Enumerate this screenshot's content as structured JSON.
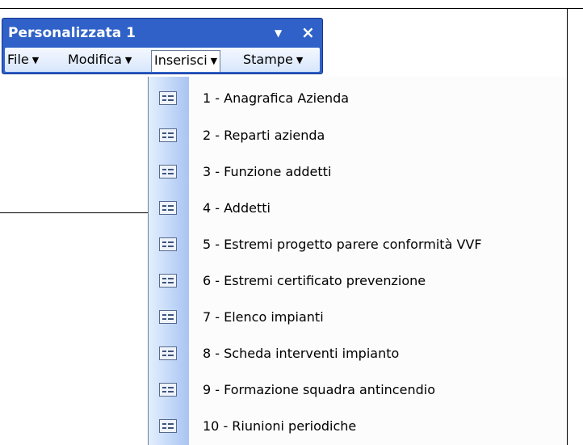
{
  "toolbar": {
    "title": "Personalizzata 1",
    "dropdown_glyph": "▼",
    "close_glyph": "×"
  },
  "menubar": {
    "items": [
      {
        "label": "File",
        "caret": "▼"
      },
      {
        "label": "Modifica",
        "caret": "▼"
      },
      {
        "label": "Inserisci",
        "caret": "▼"
      },
      {
        "label": "Stampe",
        "caret": "▼"
      }
    ],
    "open_menu": "Inserisci"
  },
  "dropdown": {
    "items": [
      {
        "label": "1 - Anagrafica Azienda",
        "icon": "form-icon"
      },
      {
        "label": "2 - Reparti azienda",
        "icon": "form-icon"
      },
      {
        "label": "3 - Funzione addetti",
        "icon": "form-icon"
      },
      {
        "label": "4 - Addetti",
        "icon": "form-icon"
      },
      {
        "label": "5 - Estremi progetto parere conformità VVF",
        "icon": "form-icon"
      },
      {
        "label": "6 - Estremi certificato prevenzione",
        "icon": "form-icon"
      },
      {
        "label": "7 - Elenco impianti",
        "icon": "form-icon"
      },
      {
        "label": "8 - Scheda interventi impianto",
        "icon": "form-icon"
      },
      {
        "label": "9 - Formazione squadra antincendio",
        "icon": "form-icon"
      },
      {
        "label": "10 - Riunioni periodiche",
        "icon": "form-icon"
      }
    ]
  },
  "colors": {
    "toolbar_blue": "#2f61c8",
    "menubar_light": "#d8e6fb",
    "icon_strip": "#a9c4f2"
  }
}
